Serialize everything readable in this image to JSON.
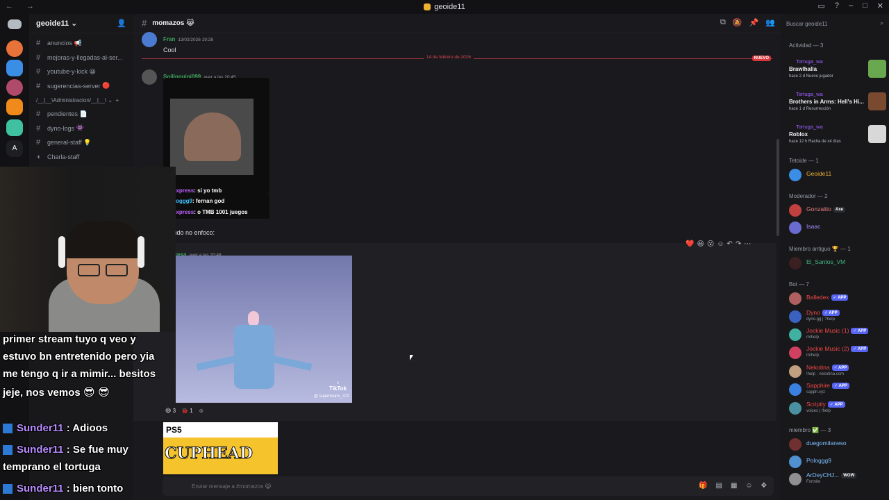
{
  "window": {
    "title": "geoide11",
    "nav": "← →"
  },
  "guild": {
    "name": "geoide11"
  },
  "channels": [
    {
      "name": "anuncios",
      "icon": "📢"
    },
    {
      "name": "mejoras-y-llegadas-al-ser...",
      "icon": ""
    },
    {
      "name": "youtube-y-kick",
      "icon": "😀"
    },
    {
      "name": "sugerencias-server",
      "icon": "🔴"
    },
    {
      "name": "pendientes",
      "icon": "📄"
    },
    {
      "name": "dyno-logs",
      "icon": "👾"
    },
    {
      "name": "general-staff",
      "icon": "💡"
    },
    {
      "name": "Charla-staff",
      "icon": ""
    }
  ],
  "category": "/__|__\\Administracion/__|__\\",
  "channel": {
    "name": "momazos",
    "emoji": "😹"
  },
  "messages": [
    {
      "author": "Fran",
      "time": "13/02/2026 19:28",
      "text": "Cool",
      "color": "#3ba55c"
    },
    {
      "author": "Soilinguini099",
      "time": "ayer a las 20:45",
      "text": "",
      "color": "#3ba55c"
    },
    {
      "author": "panfresa",
      "time": "ayer a las 20:48",
      "text": "",
      "color": "#3ba55c"
    }
  ],
  "divider": {
    "date": "14 de febrero de 2026",
    "badge": "NUEVO"
  },
  "video_caption": "cuando no enfoco:",
  "clip_chat": [
    {
      "user": "eroxpress",
      "text": ": si yo tmb"
    },
    {
      "user": "pologgg9",
      "text": ": fernan god"
    },
    {
      "user": "eroxpress",
      "text": ": o TMB 1001 juegos"
    }
  ],
  "tiktok": {
    "label": "TikTok",
    "handle": "@ supermario_472"
  },
  "reactions": [
    {
      "emoji": "😄",
      "count": "3"
    },
    {
      "emoji": "🐞",
      "count": "1"
    }
  ],
  "cuphead": {
    "platform": "PS5",
    "title": "CUPHEAD"
  },
  "composer": {
    "placeholder": "Enviar mensaje a #momazos 😹"
  },
  "members_panel": {
    "search": "Buscar geoide11",
    "activity_header": "Actividad — 3",
    "activities": [
      {
        "user": "Tortuga_wa",
        "game": "Brawlhalla",
        "meta": "hace 2 d   Nuevo jugador"
      },
      {
        "user": "Tortuga_wa",
        "game": "Brothers in Arms: Hell's Hi...",
        "meta": "hace 1 d   Resurrección"
      },
      {
        "user": "Tortuga_wa",
        "game": "Roblox",
        "meta": "hace 12 h   Racha de x4 días"
      }
    ],
    "groups": [
      {
        "title": "Tetoide — 1",
        "members": [
          {
            "name": "Geoide11",
            "color": "#f0b232",
            "sub": "",
            "app": false
          }
        ]
      },
      {
        "title": "Moderador — 2",
        "members": [
          {
            "name": "Gonzalito",
            "color": "#e87f7f",
            "sub": "",
            "app": false,
            "tag": "Axe"
          },
          {
            "name": "Isaac",
            "color": "#a78bfa",
            "sub": "",
            "app": false
          }
        ]
      },
      {
        "title": "Miembro antiguo 🏆 — 1",
        "members": [
          {
            "name": "El_Santos_VM",
            "color": "#43b581",
            "sub": "",
            "app": false
          }
        ]
      },
      {
        "title": "Bot — 7",
        "members": [
          {
            "name": "Balledex",
            "color": "#f04747",
            "sub": "",
            "app": true
          },
          {
            "name": "Dyno",
            "color": "#f04747",
            "sub": "dyno.gg | ?help",
            "app": true
          },
          {
            "name": "Jockie Music (1)",
            "color": "#f04747",
            "sub": "m!help",
            "app": true
          },
          {
            "name": "Jockie Music (2)",
            "color": "#f04747",
            "sub": "m!help",
            "app": true
          },
          {
            "name": "Nekotina",
            "color": "#f04747",
            "sub": "!help · nekotina.com",
            "app": true
          },
          {
            "name": "Sapphire",
            "color": "#f04747",
            "sub": "sapph.xyz",
            "app": true
          },
          {
            "name": "Scriptly",
            "color": "#f04747",
            "sub": "voices  | /help",
            "app": true
          }
        ]
      },
      {
        "title": "miembro ✅ — 3",
        "members": [
          {
            "name": "duegomilaneso",
            "color": "#7fbfff",
            "sub": "",
            "app": false
          },
          {
            "name": "Pologgg9",
            "color": "#7fbfff",
            "sub": "",
            "app": false
          },
          {
            "name": "ArDeyCHJ...",
            "color": "#7fbfff",
            "sub": "Fortnite",
            "app": false,
            "tag": "WOW"
          }
        ]
      }
    ]
  },
  "stream_overlay": {
    "chat": [
      {
        "user": "",
        "text": "primer stream tuyo q veo y"
      },
      {
        "user": "",
        "text": "estuvo bn entretenido pero yia"
      },
      {
        "user": "",
        "text": "me tengo q ir a mimir... besitos"
      },
      {
        "user": "",
        "text": "jeje, nos vemos"
      }
    ],
    "lines": [
      {
        "user": "Sunder11",
        "text": " : Adioos"
      },
      {
        "user": "Sunder11",
        "text": " : Se fue muy"
      },
      {
        "user": "",
        "text": "temprano el tortuga"
      },
      {
        "user": "Sunder11",
        "text": " :    bien tonto"
      }
    ]
  },
  "colors": {
    "bg": "#1a1a1e",
    "sidebar": "#18181b",
    "accent": "#5865f2",
    "new": "#da373c"
  }
}
